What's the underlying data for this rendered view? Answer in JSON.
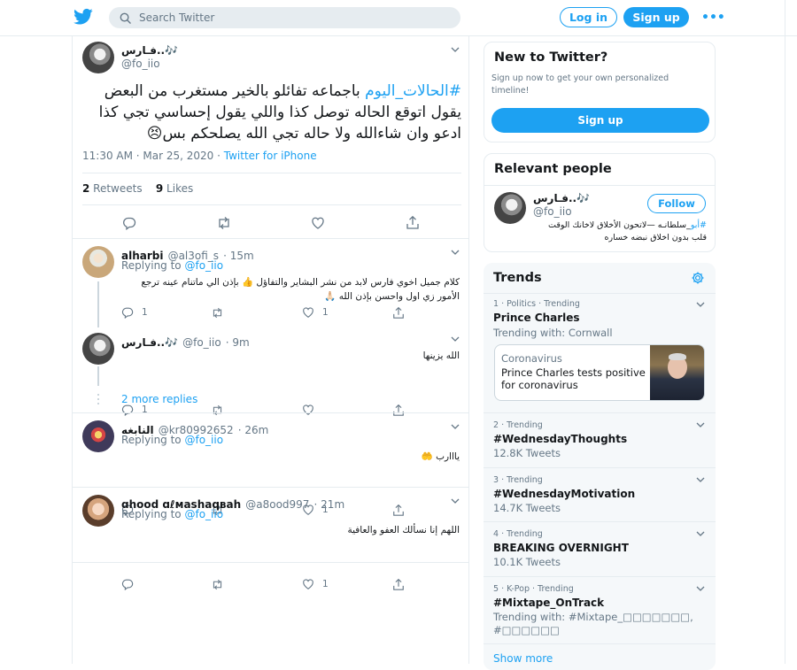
{
  "search": {
    "placeholder": "Search Twitter"
  },
  "header": {
    "login": "Log in",
    "signup": "Sign up",
    "more": "•••"
  },
  "tweet": {
    "name": "فـارس..🎶",
    "handle": "@fo_iio",
    "hashtag": "#الحالات_اليوم",
    "text": " باجماعه تفائلو بالخير مستغرب من البعض يقول اتوقع الحاله توصل كذا واللي يقول إحساسي تجي كذا ادعو وان شاءالله ولا حاله تجي الله يصلحكم بس😣",
    "time": "11:30 AM · Mar 25, 2020 · ",
    "source": "Twitter for iPhone",
    "retweets": "2",
    "retweets_label": " Retweets",
    "likes": "9",
    "likes_label": " Likes"
  },
  "replies": [
    {
      "name": "alharbi",
      "handle": "@al3ofi_s",
      "time": "· 15m",
      "replying": "Replying to ",
      "replying_to": "@fo_iio",
      "text": "كلام جميل اخوي فارس لابد من نشر البشاير والتفاؤل 👍 بإذن الي ماتنام عينه ترجع الأمور زي اول واحسن بإذن الله 🙏🏻",
      "reply_count": "1",
      "like_count": "1"
    },
    {
      "name": "فـارس..🎶",
      "handle": "@fo_iio",
      "time": "· 9m",
      "text": "الله يزينها",
      "reply_count": "1",
      "like_count": ""
    },
    {
      "name": "النابغه",
      "handle": "@kr80992652",
      "time": "· 26m",
      "replying": "Replying to ",
      "replying_to": "@fo_iio",
      "text": "يااارب 🤲",
      "reply_count": "",
      "like_count": "1"
    },
    {
      "name": "ɑhood ɑℓмashaqвah",
      "handle": "@a8ood997",
      "time": "· 21m",
      "replying": "Replying to ",
      "replying_to": "@fo_iio",
      "text": "اللهم إنا نسألك العفو والعافية",
      "reply_count": "",
      "like_count": "1"
    }
  ],
  "more_replies": "2 more replies",
  "new_to_twitter": {
    "title": "New to Twitter?",
    "text": "Sign up now to get your own personalized timeline!",
    "button": "Sign up"
  },
  "relevant": {
    "title": "Relevant people",
    "name": "فـارس..🎶",
    "handle": "@fo_iio",
    "follow": "Follow",
    "bio_link": "#أبو",
    "bio": "_سلطانـه —لاتحون الأخلاق لاخانك الوقت قلب بدون اخلاق نبضه خساره"
  },
  "trends": {
    "title": "Trends",
    "items": [
      {
        "sub": "1 · Politics · Trending",
        "title": "Prince Charles",
        "count": "Trending with: Cornwall",
        "card": {
          "label": "Coronavirus",
          "text": "Prince Charles tests positive for coronavirus"
        }
      },
      {
        "sub": "2 · Trending",
        "title": "#WednesdayThoughts",
        "count": "12.8K Tweets"
      },
      {
        "sub": "3 · Trending",
        "title": "#WednesdayMotivation",
        "count": "14.7K Tweets"
      },
      {
        "sub": "4 · Trending",
        "title": "BREAKING OVERNIGHT",
        "count": "10.1K Tweets"
      },
      {
        "sub": "5 · K-Pop · Trending",
        "title": "#Mixtape_OnTrack",
        "count": "Trending with: #Mixtape_□□□□□□□, #□□□□□□"
      }
    ],
    "show_more": "Show more"
  },
  "colors": {
    "accent": "#1da1f2",
    "text": "#14171a",
    "muted": "#657786",
    "border": "#e6ecf0"
  }
}
